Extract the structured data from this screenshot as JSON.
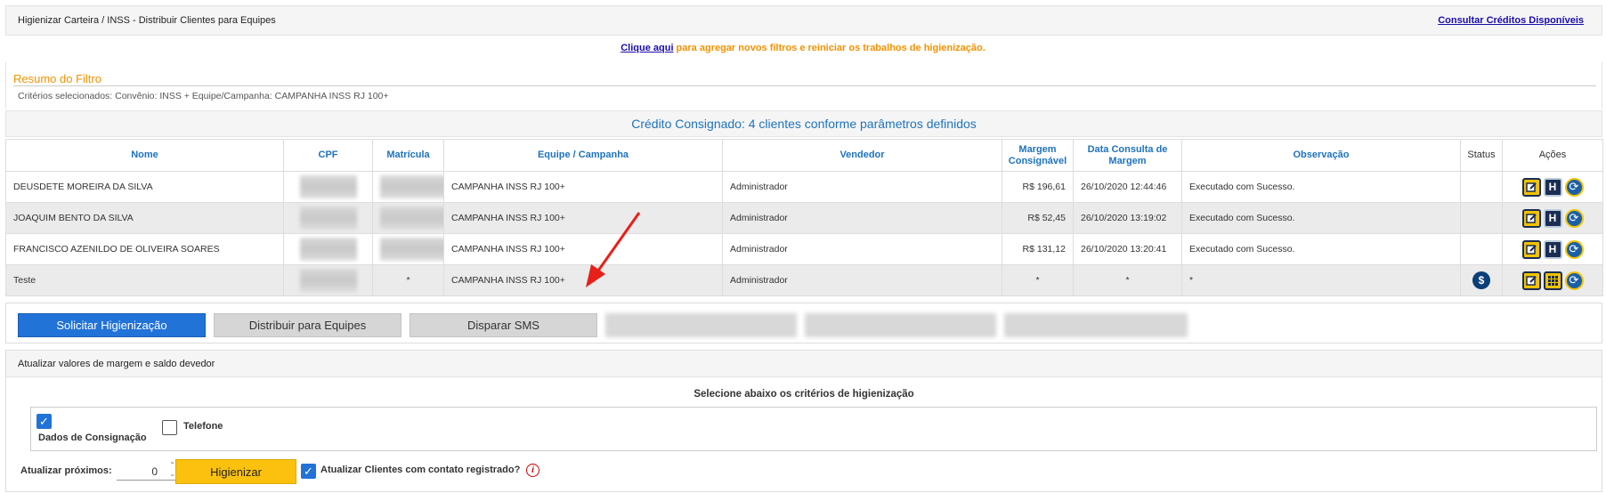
{
  "header": {
    "breadcrumb": "Higienizar Carteira / INSS - Distribuir Clientes para Equipes",
    "credits_link": "Consultar Créditos Disponíveis"
  },
  "notice": {
    "link": "Clique aqui",
    "text": " para agregar novos filtros e reiniciar os trabalhos de higienização."
  },
  "resumo": {
    "title": "Resumo do Filtro",
    "criteria": "Critérios selecionados: Convênio: INSS + Equipe/Campanha: CAMPANHA INSS RJ 100+"
  },
  "summary": "Crédito Consignado: 4 clientes conforme parâmetros definidos",
  "table": {
    "headers": [
      "Nome",
      "CPF",
      "Matrícula",
      "Equipe / Campanha",
      "Vendedor",
      "Margem Consignável",
      "Data Consulta de Margem",
      "Observação",
      "Status",
      "Ações"
    ],
    "rows": [
      {
        "nome": "DEUSDETE MOREIRA DA SILVA",
        "matricula": "",
        "equipe": "CAMPANHA INSS RJ 100+",
        "vendedor": "Administrador",
        "margem": "R$ 196,61",
        "data": "26/10/2020 12:44:46",
        "obs": "Executado com Sucesso."
      },
      {
        "nome": "JOAQUIM BENTO DA SILVA",
        "matricula": "",
        "equipe": "CAMPANHA INSS RJ 100+",
        "vendedor": "Administrador",
        "margem": "R$ 52,45",
        "data": "26/10/2020 13:19:02",
        "obs": "Executado com Sucesso."
      },
      {
        "nome": "FRANCISCO AZENILDO DE OLIVEIRA SOARES",
        "matricula": "",
        "equipe": "CAMPANHA INSS RJ 100+",
        "vendedor": "Administrador",
        "margem": "R$ 131,12",
        "data": "26/10/2020 13:20:41",
        "obs": "Executado com Sucesso."
      },
      {
        "nome": "Teste",
        "matricula": "*",
        "equipe": "CAMPANHA INSS RJ 100+",
        "vendedor": "Administrador",
        "margem": "*",
        "data": "*",
        "obs": "*"
      }
    ],
    "status_icon": "dollar-icon"
  },
  "buttons": {
    "solicitar": "Solicitar Higienização",
    "distribuir": "Distribuir para Equipes",
    "sms": "Disparar SMS"
  },
  "atualizar": {
    "title": "Atualizar valores de margem e saldo devedor",
    "criteria_title": "Selecione abaixo os critérios de higienização",
    "dados_label": "Dados de Consignação",
    "telefone_label": "Telefone",
    "proximos_label": "Atualizar próximos:",
    "proximos_value": "0",
    "higienizar_button": "Higienizar",
    "contato_label": "Atualizar Clientes com contato registrado?"
  },
  "colors": {
    "accent_blue": "#2173d8",
    "orange": "#f39200",
    "header_blue": "#1e73be",
    "arrow_red": "#e8201a",
    "higienizar_yellow": "#fcc10f"
  }
}
